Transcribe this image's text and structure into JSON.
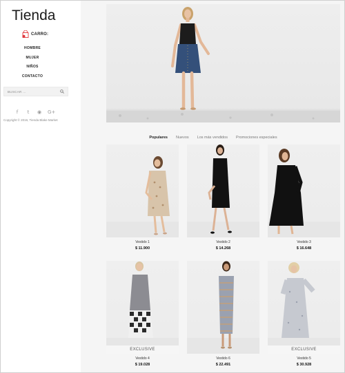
{
  "brand": {
    "title": "Tienda"
  },
  "cart": {
    "label": "CARRO:",
    "icon": "shopping-bag-icon"
  },
  "nav": {
    "items": [
      {
        "label": "HOMBRE"
      },
      {
        "label": "MUJER"
      },
      {
        "label": "NIÑOS"
      },
      {
        "label": "CONTACTO"
      }
    ]
  },
  "search": {
    "placeholder": "BUSCAR ...",
    "icon": "search-icon"
  },
  "social": {
    "icons": [
      "facebook-icon",
      "twitter-icon",
      "rss-icon",
      "google-plus-icon"
    ],
    "glyphs": [
      "f",
      "t",
      "◉",
      "G+"
    ]
  },
  "footer": {
    "copyright": "Copyright © 2016, Tienda Blake Market"
  },
  "tabs": [
    {
      "label": "Populares",
      "active": true
    },
    {
      "label": "Nuevos",
      "active": false
    },
    {
      "label": "Los más vendidos",
      "active": false
    },
    {
      "label": "Promociones especiales",
      "active": false
    }
  ],
  "products": [
    {
      "name": "Vestido 1",
      "price": "$ 11.900",
      "badge": ""
    },
    {
      "name": "Vestido 2",
      "price": "$ 14.268",
      "badge": ""
    },
    {
      "name": "Vestido 3",
      "price": "$ 16.648",
      "badge": ""
    },
    {
      "name": "Vestido 4",
      "price": "$ 19.028",
      "badge": "EXCLUSIVE"
    },
    {
      "name": "Vestido 6",
      "price": "$ 22.491",
      "badge": ""
    },
    {
      "name": "Vestido 5",
      "price": "$ 30.928",
      "badge": "EXCLUSIVE"
    }
  ],
  "colors": {
    "accent": "#e0393e",
    "sidebar_bg": "#ffffff",
    "main_bg": "#f5f5f5"
  }
}
